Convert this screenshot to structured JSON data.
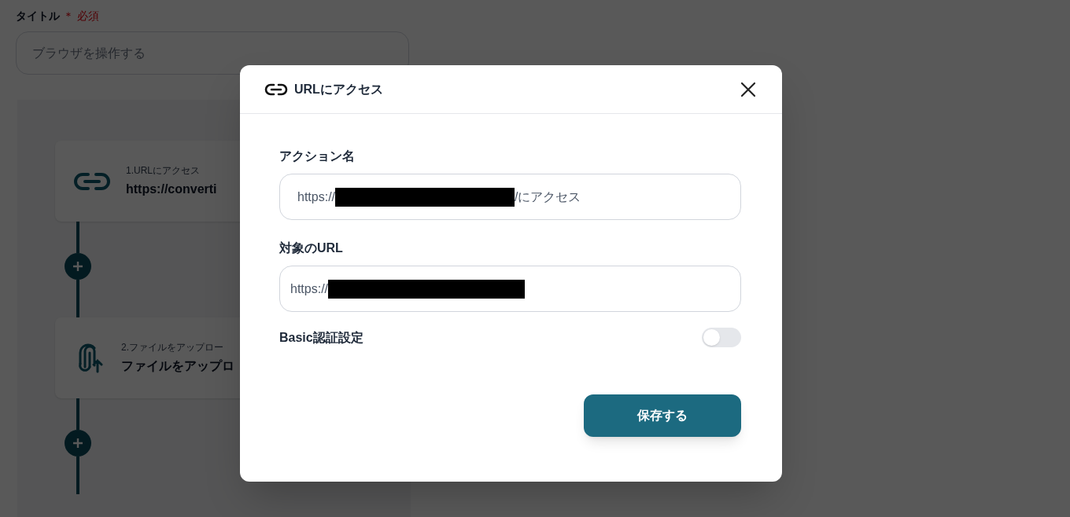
{
  "page": {
    "title_label": "タイトル",
    "required_mark": "＊ 必須",
    "title_value": "ブラウザを操作する",
    "steps": [
      {
        "kind": "link",
        "caption": "1.URLにアクセス",
        "name": "https://converti"
      },
      {
        "kind": "upload",
        "caption": "2.ファイルをアップロー",
        "name": "ファイルをアップロ"
      }
    ]
  },
  "modal": {
    "title": "URLにアクセス",
    "fields": [
      {
        "label": "アクション名",
        "value_before": "https://",
        "redacted": true,
        "value_after": "/にアクセス"
      },
      {
        "label": "対象のURL",
        "value_before": "https://",
        "redacted": true
      }
    ],
    "basic_auth": {
      "label": "Basic認証設定",
      "on": false
    },
    "save_button": "保存する"
  }
}
